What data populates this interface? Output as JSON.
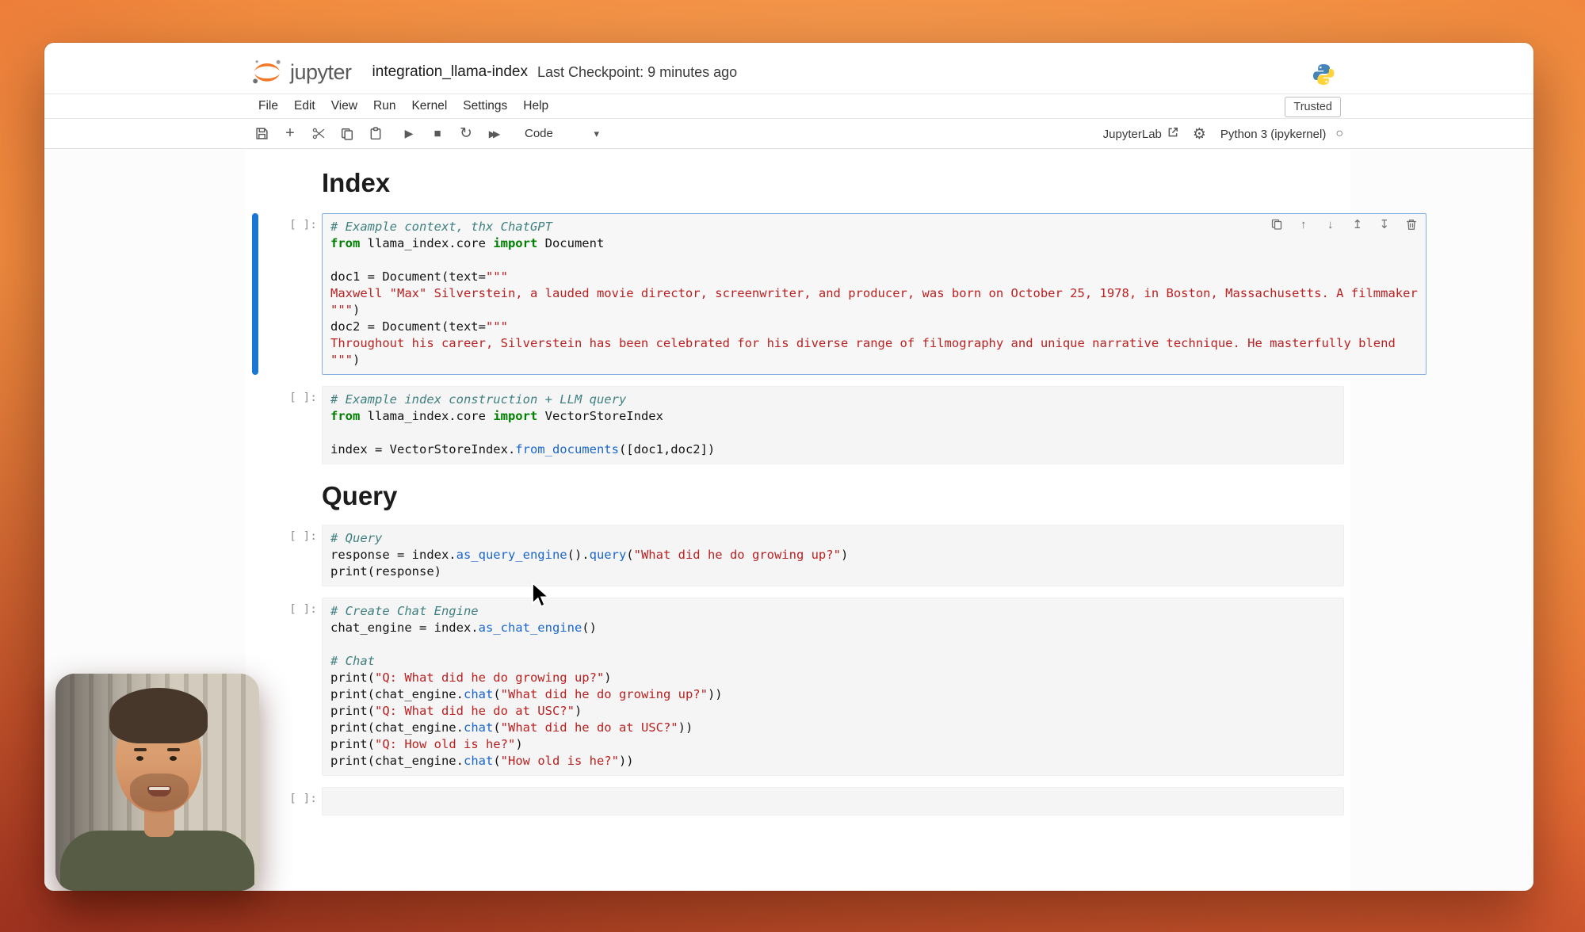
{
  "header": {
    "brand": "jupyter",
    "title": "integration_llama-index",
    "checkpoint": "Last Checkpoint: 9 minutes ago",
    "trusted": "Trusted"
  },
  "menu": {
    "items": [
      "File",
      "Edit",
      "View",
      "Run",
      "Kernel",
      "Settings",
      "Help"
    ]
  },
  "toolbar": {
    "cell_type": "Code",
    "jupyterlab": "JupyterLab",
    "kernel_name": "Python 3 (ipykernel)",
    "icons": {
      "add": "+",
      "run": "▶",
      "stop": "■",
      "restart": "↻",
      "run_all": "▶▶",
      "chevron_down": "▾",
      "gear": "⚙",
      "kernel_status": "○"
    }
  },
  "cell_toolbar": {
    "icons": {
      "move_up": "↑",
      "move_down": "↓",
      "insert_above": "↥",
      "insert_below": "↧"
    }
  },
  "notebook": {
    "heading_index": "Index",
    "heading_query": "Query",
    "prompt": "[ ]:",
    "cells": [
      {
        "selected": true,
        "lines": [
          [
            [
              "com",
              "# Example context, thx ChatGPT"
            ]
          ],
          [
            [
              "kw",
              "from"
            ],
            [
              "pl",
              " llama_index.core "
            ],
            [
              "kw",
              "import"
            ],
            [
              "pl",
              " Document"
            ]
          ],
          [],
          [
            [
              "pl",
              "doc1 = Document(text="
            ],
            [
              "str",
              "\"\"\""
            ]
          ],
          [
            [
              "str",
              "Maxwell \"Max\" Silverstein, a lauded movie director, screenwriter, and producer, was born on October 25, 1978, in Boston, Massachusetts. A filmmaker"
            ]
          ],
          [
            [
              "str",
              "\"\"\""
            ],
            [
              "pl",
              ")"
            ]
          ],
          [
            [
              "pl",
              "doc2 = Document(text="
            ],
            [
              "str",
              "\"\"\""
            ]
          ],
          [
            [
              "str",
              "Throughout his career, Silverstein has been celebrated for his diverse range of filmography and unique narrative technique. He masterfully blend"
            ]
          ],
          [
            [
              "str",
              "\"\"\""
            ],
            [
              "pl",
              ")"
            ]
          ]
        ]
      },
      {
        "selected": false,
        "lines": [
          [
            [
              "com",
              "# Example index construction + LLM query"
            ]
          ],
          [
            [
              "kw",
              "from"
            ],
            [
              "pl",
              " llama_index.core "
            ],
            [
              "kw",
              "import"
            ],
            [
              "pl",
              " VectorStoreIndex"
            ]
          ],
          [],
          [
            [
              "pl",
              "index = VectorStoreIndex."
            ],
            [
              "fn",
              "from_documents"
            ],
            [
              "pl",
              "([doc1,doc2])"
            ]
          ]
        ]
      },
      {
        "selected": false,
        "lines": [
          [
            [
              "com",
              "# Query"
            ]
          ],
          [
            [
              "pl",
              "response = index."
            ],
            [
              "fn",
              "as_query_engine"
            ],
            [
              "pl",
              "()."
            ],
            [
              "fn",
              "query"
            ],
            [
              "pl",
              "("
            ],
            [
              "str",
              "\"What did he do growing up?\""
            ],
            [
              "pl",
              ")"
            ]
          ],
          [
            [
              "pl",
              "print(response)"
            ]
          ]
        ]
      },
      {
        "selected": false,
        "lines": [
          [
            [
              "com",
              "# Create Chat Engine"
            ]
          ],
          [
            [
              "pl",
              "chat_engine = index."
            ],
            [
              "fn",
              "as_chat_engine"
            ],
            [
              "pl",
              "()"
            ]
          ],
          [],
          [
            [
              "com",
              "# Chat"
            ]
          ],
          [
            [
              "pl",
              "print("
            ],
            [
              "str",
              "\"Q: What did he do growing up?\""
            ],
            [
              "pl",
              ")"
            ]
          ],
          [
            [
              "pl",
              "print(chat_engine."
            ],
            [
              "fn",
              "chat"
            ],
            [
              "pl",
              "("
            ],
            [
              "str",
              "\"What did he do growing up?\""
            ],
            [
              "pl",
              "))"
            ]
          ],
          [
            [
              "pl",
              "print("
            ],
            [
              "str",
              "\"Q: What did he do at USC?\""
            ],
            [
              "pl",
              ")"
            ]
          ],
          [
            [
              "pl",
              "print(chat_engine."
            ],
            [
              "fn",
              "chat"
            ],
            [
              "pl",
              "("
            ],
            [
              "str",
              "\"What did he do at USC?\""
            ],
            [
              "pl",
              "))"
            ]
          ],
          [
            [
              "pl",
              "print("
            ],
            [
              "str",
              "\"Q: How old is he?\""
            ],
            [
              "pl",
              ")"
            ]
          ],
          [
            [
              "pl",
              "print(chat_engine."
            ],
            [
              "fn",
              "chat"
            ],
            [
              "pl",
              "("
            ],
            [
              "str",
              "\"How old is he?\""
            ],
            [
              "pl",
              "))"
            ]
          ]
        ]
      },
      {
        "selected": false,
        "lines": [
          []
        ]
      }
    ]
  },
  "colors": {
    "accent_blue": "#1976d2",
    "jupyter_orange": "#f37726",
    "comment": "#408080",
    "keyword": "#008000",
    "string": "#ba2121",
    "function": "#1a66cc"
  }
}
